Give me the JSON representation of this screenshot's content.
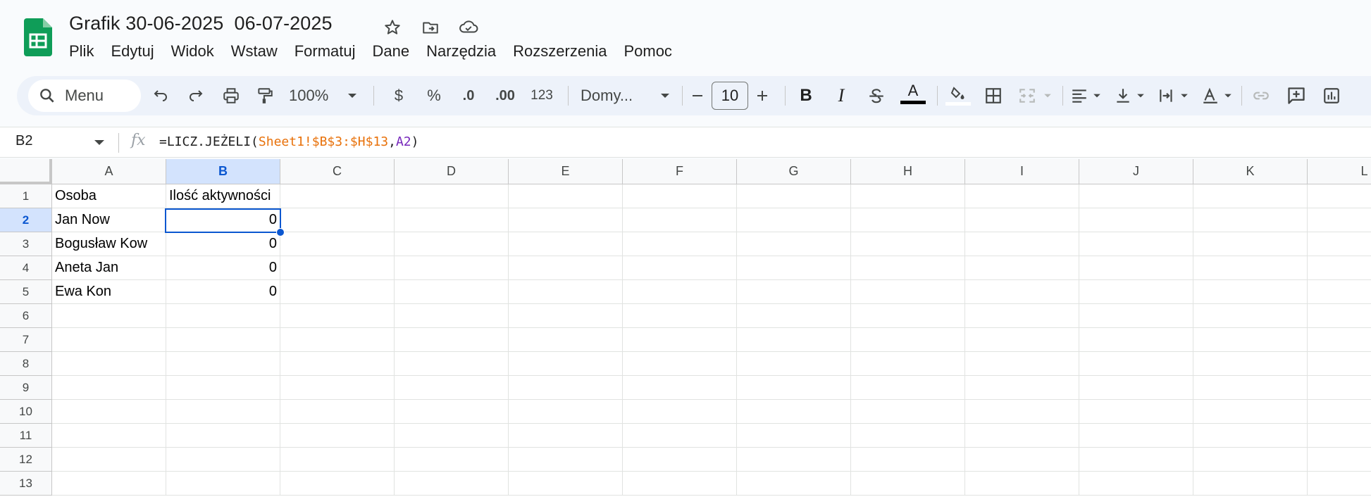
{
  "document": {
    "title": "Grafik 30-06-2025  06-07-2025",
    "icons": [
      "star-icon",
      "move-to-folder-icon",
      "cloud-saved-icon"
    ]
  },
  "menu": [
    "Plik",
    "Edytuj",
    "Widok",
    "Wstaw",
    "Formatuj",
    "Dane",
    "Narzędzia",
    "Rozszerzenia",
    "Pomoc"
  ],
  "toolbar": {
    "search_label": "Menu",
    "zoom": "100%",
    "currency": "$",
    "percent": "%",
    "decrease_decimals": ".0",
    "increase_decimals": ".00",
    "number_format": "123",
    "font": "Domy...",
    "font_size": "10",
    "text_color": "#000000"
  },
  "formula_bar": {
    "cell_ref": "B2",
    "fx": "fx",
    "formula_prefix": "=LICZ.JEŻELI(",
    "formula_ref1": "Sheet1!$B$3:$H$13",
    "formula_comma": ",",
    "formula_ref2": "A2",
    "formula_suffix": ")"
  },
  "grid": {
    "columns": [
      "A",
      "B",
      "C",
      "D",
      "E",
      "F",
      "G",
      "H",
      "I",
      "J",
      "K",
      "L"
    ],
    "selected_column": "B",
    "rows": [
      "1",
      "2",
      "3",
      "4",
      "5",
      "6",
      "7",
      "8",
      "9",
      "10",
      "11",
      "12",
      "13"
    ],
    "selected_row": "2",
    "cells": {
      "A1": "Osoba",
      "B1": "Ilość aktywności",
      "A2": "Jan Now",
      "B2": "0",
      "A3": "Bogusław Kow",
      "B3": "0",
      "A4": "Aneta Jan",
      "B4": "0",
      "A5": "Ewa Kon",
      "B5": "0"
    },
    "selected_cell": "B2",
    "selection_color": "#0b57d0"
  },
  "colors": {
    "sheets_green": "#0f9d58",
    "header_bg": "#f8f9fa",
    "selected_header_bg": "#d3e3fd",
    "toolbar_bg": "#edf2fa",
    "formula_ref1": "#e8710a",
    "formula_ref2": "#7627bb"
  }
}
